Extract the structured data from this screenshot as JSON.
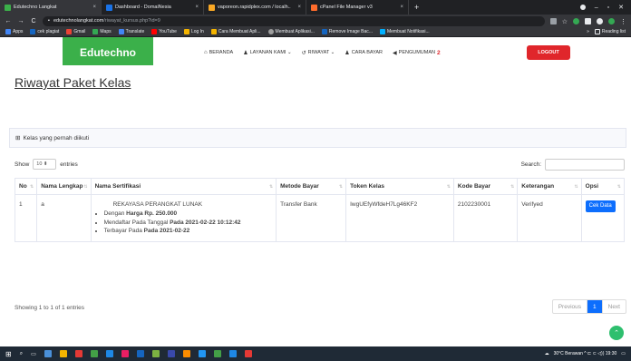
{
  "browser": {
    "tabs": [
      {
        "title": "Edutechno Langkat",
        "close": "×",
        "color": "#3bb04a",
        "active": true
      },
      {
        "title": "Dashboard - DomaiNesia",
        "close": "×",
        "color": "#1a73e8",
        "active": false
      },
      {
        "title": "vaporeon.rapidplex.com / localh...",
        "close": "×",
        "color": "#f9a825",
        "active": false
      },
      {
        "title": "cPanel File Manager v3",
        "close": "×",
        "color": "#ff6c2c",
        "active": false
      }
    ],
    "new_tab": "+",
    "address": {
      "host": "edutechnolangkat.com",
      "path": "/riwayat_kursus.php?id=9"
    },
    "bookmarks": [
      {
        "label": "Apps",
        "color": "#4285f4"
      },
      {
        "label": "cek plagiat",
        "color": "#1565c0"
      },
      {
        "label": "Gmail",
        "color": "#ea4335"
      },
      {
        "label": "Maps",
        "color": "#34a853"
      },
      {
        "label": "Translate",
        "color": "#4285f4"
      },
      {
        "label": "YouTube",
        "color": "#ff0000"
      },
      {
        "label": "Log In",
        "color": "#f4b400"
      },
      {
        "label": "Cara Membuat Apli...",
        "color": "#f4b400"
      },
      {
        "label": "Membuat Aplikasi...",
        "color": "#9e9e9e"
      },
      {
        "label": "Remove Image Bac...",
        "color": "#1565c0"
      },
      {
        "label": "Membuat Notifikasi...",
        "color": "#00b0ff"
      }
    ],
    "bookmarks_more": "»",
    "reading_list": "Reading list"
  },
  "site": {
    "brand": "Edutechno",
    "nav": [
      {
        "icon": "home-icon",
        "glyph": "⌂",
        "label": "BERANDA"
      },
      {
        "icon": "user-icon",
        "glyph": "♟",
        "label": "LAYANAN KAMI ⌄"
      },
      {
        "icon": "history-icon",
        "glyph": "↺",
        "label": "RIWAYAT ⌄"
      },
      {
        "icon": "people-icon",
        "glyph": "♟",
        "label": "CARA BAYAR"
      },
      {
        "icon": "megaphone-icon",
        "glyph": "◀",
        "label": "PENGUMUMAN",
        "badge": "2"
      }
    ],
    "logout": "LOGOUT"
  },
  "page": {
    "title": "Riwayat Paket Kelas",
    "card_title": "Kelas yang pernah diikuti",
    "show_label": "Show",
    "show_value": "10",
    "entries_label": "entries",
    "search_label": "Search:",
    "columns": [
      "No",
      "Nama Lengkap",
      "Nama Sertifikasi",
      "Metode Bayar",
      "Token Kelas",
      "Kode Bayar",
      "Keterangan",
      "Opsi"
    ],
    "rows": [
      {
        "no": "1",
        "nama": "a",
        "sertifikasi_title": "REKAYASA PERANGKAT LUNAK",
        "detail_1_prefix": "Dengan ",
        "detail_1_value": "Harga Rp. 250.000",
        "detail_2_prefix": "Mendaftar Pada Tanggal ",
        "detail_2_value": "Pada 2021-02-22 10:12:42",
        "detail_3_prefix": "Terbayar Pada ",
        "detail_3_value": "Pada 2021-02-22",
        "metode": "Transfer Bank",
        "token": "IwgUEfyWfdeH7Lg46KF2",
        "kode": "2102230001",
        "keterangan": "Verifyed",
        "opsi": "Cek Data"
      }
    ],
    "info": "Showing 1 to 1 of 1 entries",
    "pager": {
      "prev": "Previous",
      "current": "1",
      "next": "Next"
    }
  },
  "taskbar": {
    "tray": "30°C Berawan ^ ⊏ ⊂ ◁)) 19:30"
  }
}
